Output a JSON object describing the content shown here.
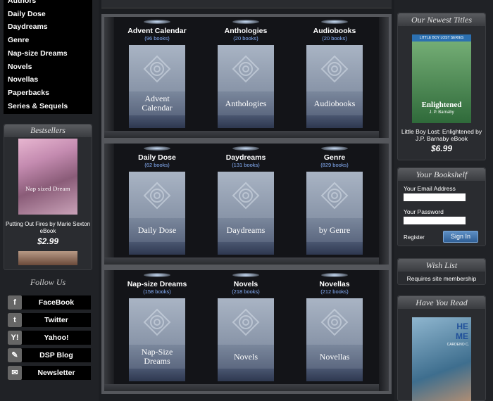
{
  "genres": [
    "Authors",
    "Daily Dose",
    "Daydreams",
    "Genre",
    "Nap-size Dreams",
    "Novels",
    "Novellas",
    "Paperbacks",
    "Series & Sequels"
  ],
  "bestsellers": {
    "heading": "Bestsellers",
    "cover_title": "Nap sized Dream",
    "caption": "Putting Out Fires by Marie Sexton eBook",
    "price": "$2.99"
  },
  "follow": {
    "heading": "Follow Us",
    "items": [
      {
        "label": "FaceBook",
        "icon": "f"
      },
      {
        "label": "Twitter",
        "icon": "t"
      },
      {
        "label": "Yahoo!",
        "icon": "Y!"
      },
      {
        "label": "DSP Blog",
        "icon": "✎"
      },
      {
        "label": "Newsletter",
        "icon": "✉"
      }
    ]
  },
  "shelves": [
    [
      {
        "title": "Advent Calendar",
        "count": "(96 books)",
        "cover": "Advent Calendar"
      },
      {
        "title": "Anthologies",
        "count": "(20 books)",
        "cover": "Anthologies"
      },
      {
        "title": "Audiobooks",
        "count": "(20 books)",
        "cover": "Audiobooks"
      }
    ],
    [
      {
        "title": "Daily Dose",
        "count": "(62 books)",
        "cover": "Daily Dose"
      },
      {
        "title": "Daydreams",
        "count": "(131 books)",
        "cover": "Daydreams"
      },
      {
        "title": "Genre",
        "count": "(829 books)",
        "cover": "by Genre"
      }
    ],
    [
      {
        "title": "Nap-size Dreams",
        "count": "(158 books)",
        "cover": "Nap-Size Dreams"
      },
      {
        "title": "Novels",
        "count": "(218 books)",
        "cover": "Novels"
      },
      {
        "title": "Novellas",
        "count": "(212 books)",
        "cover": "Novellas"
      }
    ]
  ],
  "newest": {
    "heading": "Our Newest Titles",
    "cover_band": "LITTLE BOY LOST SERIES",
    "cover_title": "Enlightened",
    "cover_author": "J. P. Barnaby",
    "caption": "Little Boy Lost: Enlightened by J.P. Barnaby eBook",
    "price": "$6.99"
  },
  "bookshelf": {
    "heading": "Your Bookshelf",
    "email_label": "Your Email Address",
    "password_label": "Your Password",
    "register": "Register",
    "signin": "Sign In"
  },
  "wishlist": {
    "heading": "Wish List",
    "note": "Requires site membership"
  },
  "haveread": {
    "heading": "Have You Read",
    "cover_t1": "HE",
    "cover_t2": "ME",
    "cover_author": "CARDENO C."
  }
}
